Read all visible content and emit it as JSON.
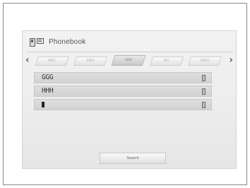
{
  "screen": {
    "title": "Phonebook",
    "tabs": [
      {
        "label": "ABC",
        "active": false
      },
      {
        "label": "DEF",
        "active": false
      },
      {
        "label": "GHI",
        "active": true
      },
      {
        "label": "JKL",
        "active": false
      },
      {
        "label": "MNO",
        "active": false
      }
    ],
    "entries": [
      {
        "label": "GGG"
      },
      {
        "label": "HHH"
      },
      {
        "label": ""
      }
    ],
    "search_label": "Search"
  },
  "icons": {
    "title_icons": [
      "phone-icon",
      "phonebook-icon"
    ],
    "row_icon": "phone-icon",
    "nav_left": "chevron-left-icon",
    "nav_right": "chevron-right-icon"
  }
}
